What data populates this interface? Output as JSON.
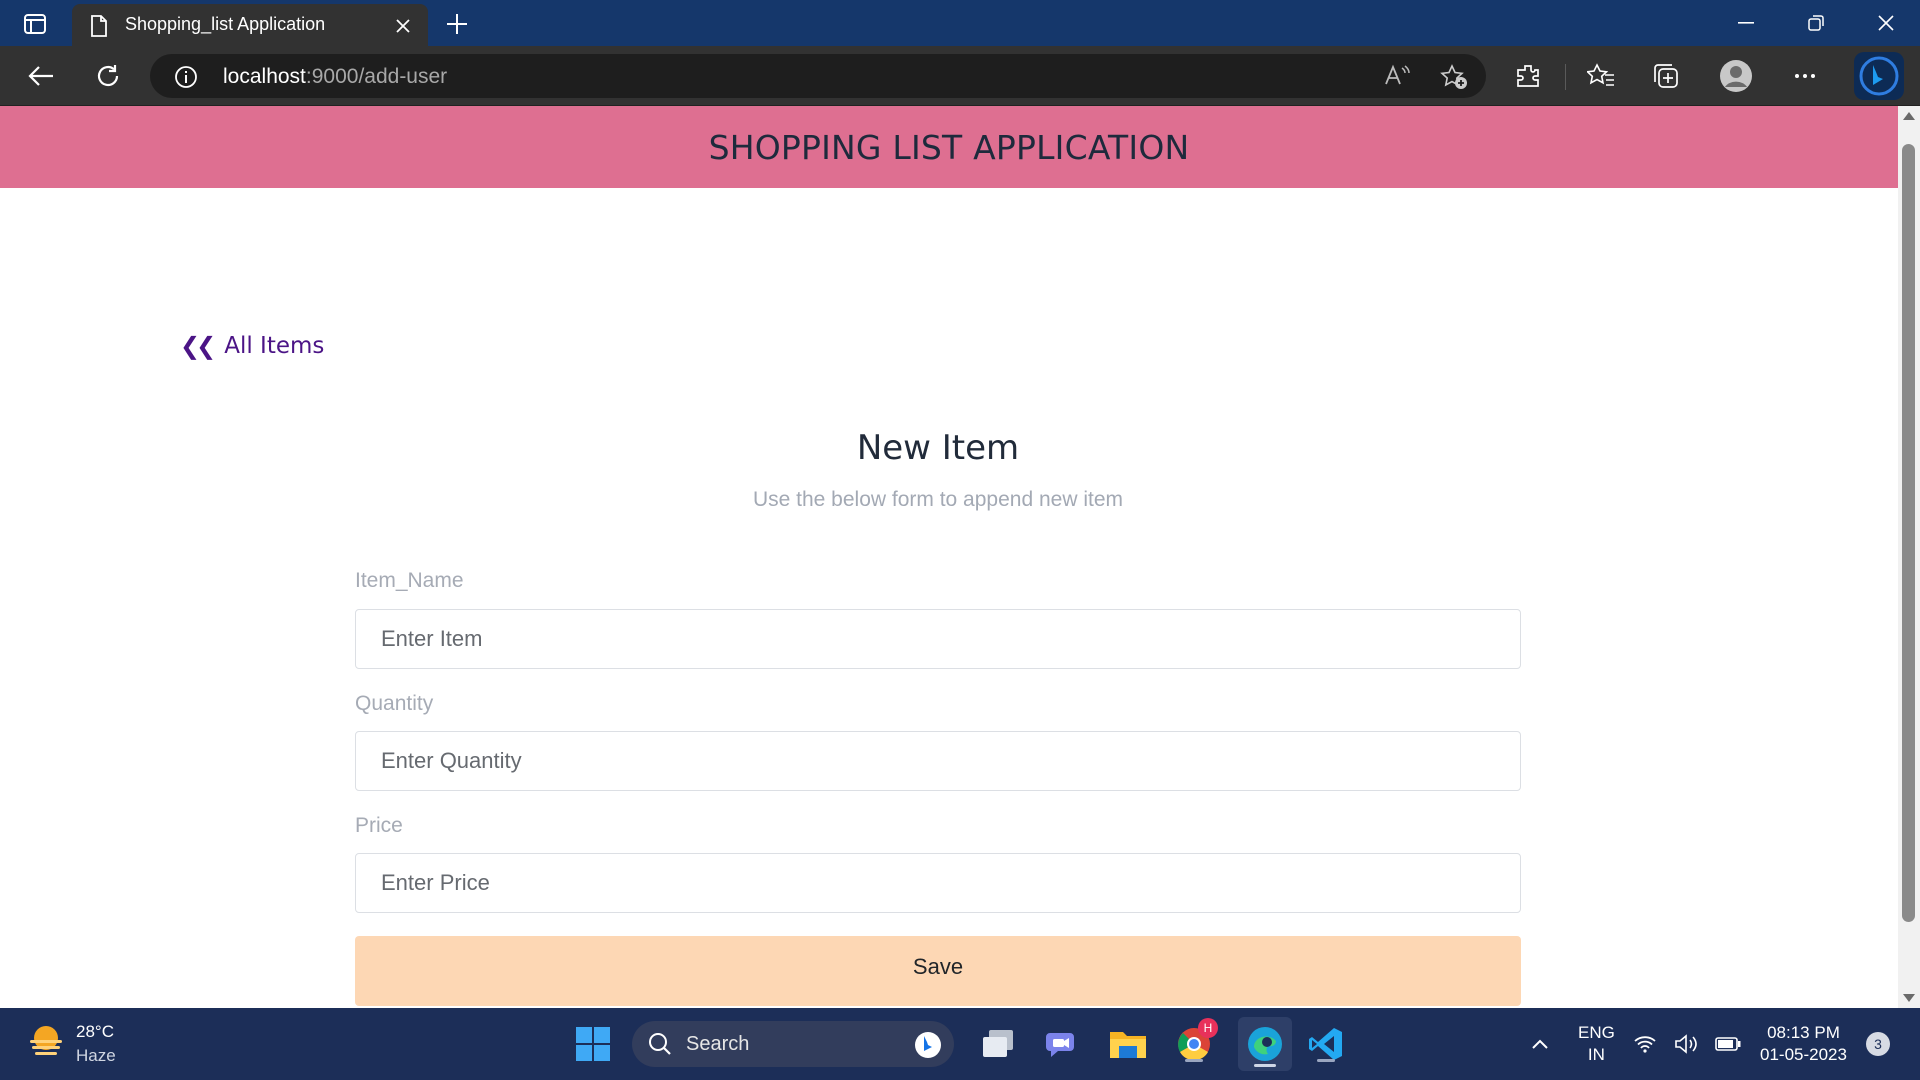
{
  "browser": {
    "tab": {
      "title": "Shopping_list Application"
    },
    "address": {
      "host": "localhost",
      "path": ":9000/add-user"
    }
  },
  "app": {
    "header_title": "SHOPPING LIST APPLICATION",
    "back_link": "All Items",
    "form": {
      "title": "New Item",
      "subtitle": "Use the below form to append new item",
      "fields": [
        {
          "label": "Item_Name",
          "placeholder": "Enter Item"
        },
        {
          "label": "Quantity",
          "placeholder": "Enter Quantity"
        },
        {
          "label": "Price",
          "placeholder": "Enter Price"
        }
      ],
      "save_label": "Save"
    },
    "colors": {
      "header_bg": "#de6f91",
      "save_bg": "#fdd7b4",
      "link": "#4b1486"
    }
  },
  "taskbar": {
    "weather": {
      "temp": "28°C",
      "condition": "Haze"
    },
    "search": {
      "label": "Search"
    },
    "chrome_badge": "H",
    "lang": {
      "line1": "ENG",
      "line2": "IN"
    },
    "clock": {
      "time": "08:13 PM",
      "date": "01-05-2023"
    },
    "notifications": "3"
  }
}
